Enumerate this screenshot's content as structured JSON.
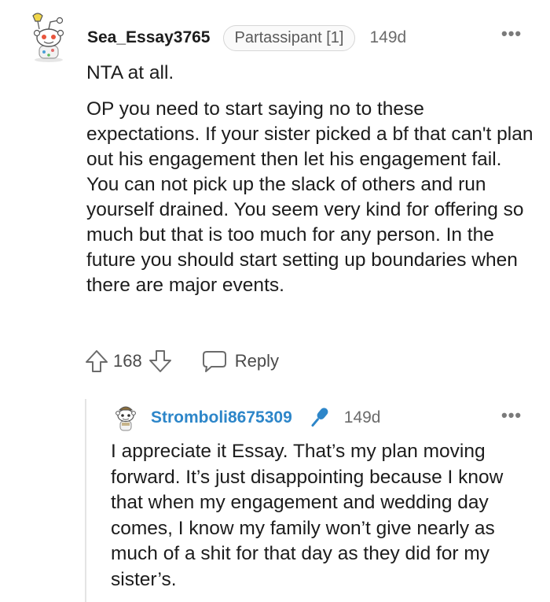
{
  "comment": {
    "author": "Sea_Essay3765",
    "flair": "Partassipant [1]",
    "age": "149d",
    "more": "•••",
    "paragraphs": [
      "NTA at all.",
      "OP you need to start saying no to these expectations. If your sister picked a bf that can't plan out his engagement then let his engagement fail. You can not pick up the slack of others and run yourself drained. You seem very kind for offering so much but that is too much for any person. In the future you should start setting up boundaries when there are major events."
    ],
    "score": "168",
    "reply_label": "Reply"
  },
  "reply": {
    "author": "Stromboli8675309",
    "age": "149d",
    "more": "•••",
    "badge_icon": "microphone-icon",
    "badge_color": "#2d86c9",
    "text": "I appreciate it Essay. That’s my plan moving forward. It’s just disappointing because I know that when my engagement and wedding day comes, I know my family won’t give nearly as much of a shit for that day as they did for my sister’s."
  }
}
